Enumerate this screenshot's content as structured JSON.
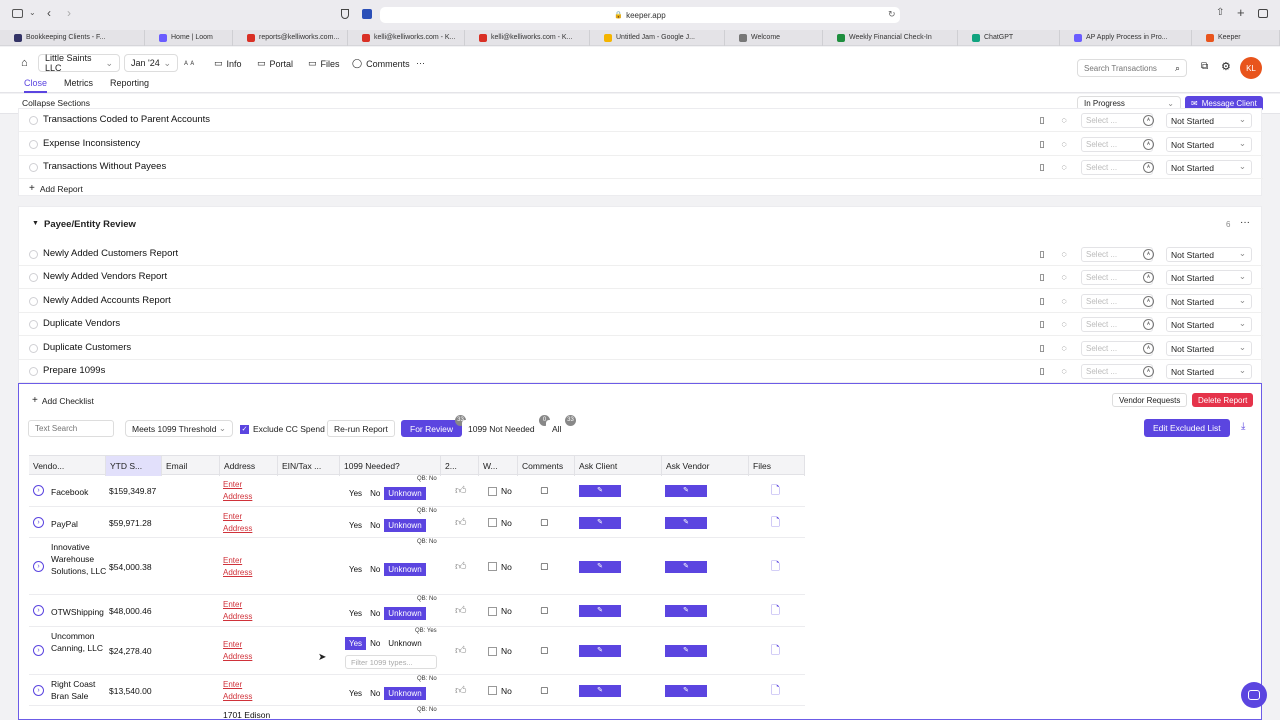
{
  "browser": {
    "url": "keeper.app",
    "tabs": [
      {
        "label": "Bookkeeping Clients - F...",
        "color": "#333366"
      },
      {
        "label": "Home | Loom",
        "color": "#6a5cff"
      },
      {
        "label": "reports@kelliworks.com...",
        "color": "#d93025"
      },
      {
        "label": "kelli@kelliworks.com - K...",
        "color": "#d93025"
      },
      {
        "label": "kelli@kelliworks.com - K...",
        "color": "#d93025"
      },
      {
        "label": "Untitled Jam - Google J...",
        "color": "#f4b400"
      },
      {
        "label": "Welcome",
        "color": "#777777"
      },
      {
        "label": "Weekly Financial Check-In",
        "color": "#1e8e3e"
      },
      {
        "label": "ChatGPT",
        "color": "#10a37f"
      },
      {
        "label": "AP Apply Process in Pro...",
        "color": "#6a5cff"
      },
      {
        "label": "Keeper",
        "color": "#e8541c"
      }
    ]
  },
  "header": {
    "client": "Little Saints LLC",
    "period": "Jan '24",
    "nav": [
      "Info",
      "Portal",
      "Files",
      "Comments"
    ],
    "more": "···",
    "search_placeholder": "Search Transactions",
    "avatar": "KL",
    "tabs": [
      "Close",
      "Metrics",
      "Reporting"
    ],
    "active_tab": "Close"
  },
  "toolbar": {
    "collapse": "Collapse Sections",
    "status": "In Progress",
    "message_client": "Message Client"
  },
  "section_top": {
    "rows": [
      "Transactions Coded to Parent Accounts",
      "Expense Inconsistency",
      "Transactions Without Payees"
    ],
    "add_report": "Add Report"
  },
  "section_payee": {
    "title": "Payee/Entity Review",
    "count": "6",
    "rows": [
      "Newly Added Customers Report",
      "Newly Added Vendors Report",
      "Newly Added Accounts Report",
      "Duplicate Vendors",
      "Duplicate Customers",
      "Prepare 1099s"
    ]
  },
  "row_common": {
    "select_placeholder": "Select ...",
    "status": "Not Started"
  },
  "prepare_1099": {
    "add_checklist": "Add Checklist",
    "vendor_requests": "Vendor Requests",
    "delete_report": "Delete Report",
    "text_search": "Text Search",
    "threshold": "Meets 1099 Threshold",
    "exclude_cc": "Exclude CC Spend",
    "rerun": "Re-run Report",
    "for_review": "For Review",
    "for_review_badge": "33",
    "not_needed": "1099 Not Needed",
    "not_needed_badge": "0",
    "all": "All",
    "all_badge": "33",
    "edit_excluded": "Edit Excluded List",
    "columns": [
      "Vendo...",
      "YTD S...",
      "Email",
      "Address",
      "EIN/Tax ...",
      "1099 Needed?",
      "2...",
      "W...",
      "Comments",
      "Ask Client",
      "Ask Vendor",
      "Files"
    ],
    "enter_address_1": "Enter",
    "enter_address_2": "Address",
    "yes": "Yes",
    "no": "No",
    "unknown": "Unknown",
    "qb_no": "QB: No",
    "qb_yes": "QB: Yes",
    "filter_types": "Filter 1099 types...",
    "vendors": [
      {
        "name": "Facebook",
        "ytd": "$159,349.87",
        "w9": "No",
        "qb": "QB: No",
        "needed": "Unknown"
      },
      {
        "name": "PayPal",
        "ytd": "$59,971.28",
        "w9": "No",
        "qb": "QB: No",
        "needed": "Unknown"
      },
      {
        "name": "Innovative Warehouse Solutions, LLC",
        "ytd": "$54,000.38",
        "w9": "No",
        "qb": "QB: No",
        "needed": "Unknown"
      },
      {
        "name": "OTWShipping",
        "ytd": "$48,000.46",
        "w9": "No",
        "qb": "QB: No",
        "needed": "Unknown"
      },
      {
        "name": "Uncommon Canning, LLC",
        "ytd": "$24,278.40",
        "w9": "No",
        "qb": "QB: Yes",
        "needed": "Yes"
      },
      {
        "name": "Right Coast Bran Sale",
        "ytd": "$13,540.00",
        "w9": "No",
        "qb": "QB: No",
        "needed": "Unknown"
      }
    ],
    "partial_address": "1701 Edison",
    "partial_qb": "QB: No"
  }
}
